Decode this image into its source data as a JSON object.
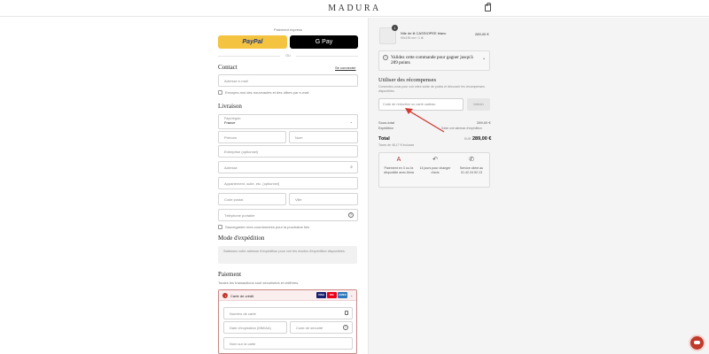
{
  "header": {
    "logo": "MADURA",
    "bag_icon": "shopping-bag-icon"
  },
  "express": {
    "title": "Paiement express",
    "paypal_label": "PayPal",
    "gpay_label": "G Pay",
    "or_label": "OU"
  },
  "contact": {
    "title": "Contact",
    "login_link": "Se connecter",
    "email_placeholder": "Adresse e-mail",
    "newsletter_label": "Envoyez-moi des nouveautés et des offres par e-mail"
  },
  "delivery": {
    "title": "Livraison",
    "country_label": "Pays/région",
    "country_value": "France",
    "first_name": "Prénom",
    "last_name": "Nom",
    "company": "Entreprise (optionnel)",
    "address": "Adresse",
    "apartment": "Appartement, suite, etc. (optionnel)",
    "postal_code": "Code postal",
    "city": "Ville",
    "phone": "Téléphone portable",
    "save_label": "Sauvegarder mes coordonnées pour la prochaine fois"
  },
  "shipping_method": {
    "title": "Mode d'expédition",
    "note": "Saisissez votre adresse d'expédition pour voir les modes d'expédition disponibles."
  },
  "payment": {
    "title": "Paiement",
    "subtitle": "Toutes les transactions sont sécurisées et chiffrées.",
    "method_label": "Carte de crédit",
    "card_brands": [
      "VISA",
      "MC",
      "AMEX"
    ],
    "card_number": "Numéro de carte",
    "expiry": "Date d'expiration (MM/AA)",
    "security_code": "Code de sécurité",
    "name_on_card": "Nom sur la carte"
  },
  "summary": {
    "quantity": "1",
    "product_name": "Nile de lit CASSIOPEE blanc",
    "product_variant": "90x190 cm / 1 lit",
    "product_price": "289,00 €",
    "reward_prompt": "Validez cette commande pour gagner jusqu'à 289 points",
    "rewards_title": "Utiliser des récompenses",
    "rewards_desc": "Connectez-vous pour voir votre solde de points et découvrir les récompenses disponibles.",
    "code_placeholder": "Code de réduction ou carte cadeau",
    "apply_button": "Valider",
    "subtotal_label": "Sous-total",
    "subtotal_value": "289,00 €",
    "shipping_label": "Expédition",
    "shipping_value": "Saisir une adresse d'expédition",
    "total_label": "Total",
    "total_currency": "EUR",
    "total_value": "289,00 €",
    "tax_note": "Taxes de 48,17 € incluses",
    "features": [
      {
        "icon": "alma-icon",
        "text": "Paiement en 3 ou 4x disponible avec Alma"
      },
      {
        "icon": "return-icon",
        "text": "14 jours pour changer d'avis"
      },
      {
        "icon": "phone-icon",
        "text": "Service client au 01.42.24.92.13"
      }
    ]
  },
  "colors": {
    "accent": "#c0392b",
    "paypal": "#f4c340",
    "gpay": "#000000",
    "panel": "#f4f4f4"
  }
}
